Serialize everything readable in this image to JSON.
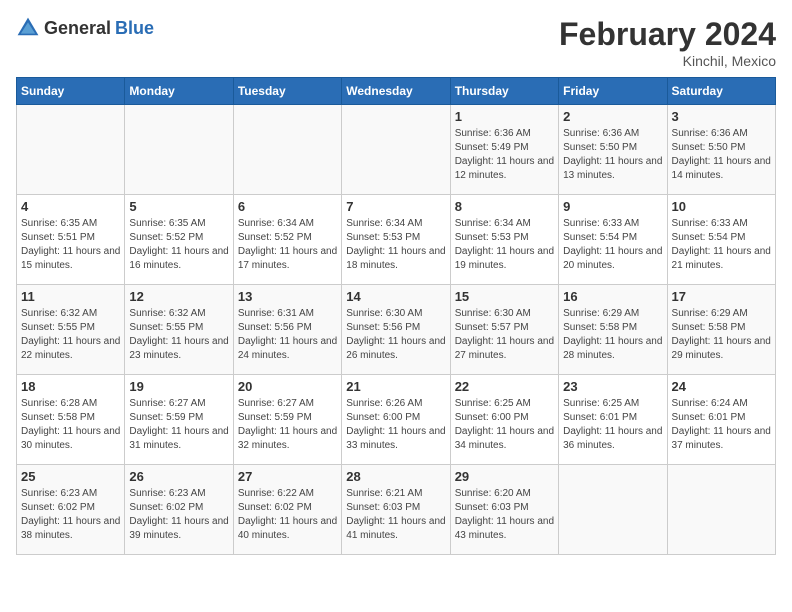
{
  "header": {
    "logo_general": "General",
    "logo_blue": "Blue",
    "month_year": "February 2024",
    "location": "Kinchil, Mexico"
  },
  "weekdays": [
    "Sunday",
    "Monday",
    "Tuesday",
    "Wednesday",
    "Thursday",
    "Friday",
    "Saturday"
  ],
  "weeks": [
    [
      {
        "day": "",
        "info": ""
      },
      {
        "day": "",
        "info": ""
      },
      {
        "day": "",
        "info": ""
      },
      {
        "day": "",
        "info": ""
      },
      {
        "day": "1",
        "info": "Sunrise: 6:36 AM\nSunset: 5:49 PM\nDaylight: 11 hours and 12 minutes."
      },
      {
        "day": "2",
        "info": "Sunrise: 6:36 AM\nSunset: 5:50 PM\nDaylight: 11 hours and 13 minutes."
      },
      {
        "day": "3",
        "info": "Sunrise: 6:36 AM\nSunset: 5:50 PM\nDaylight: 11 hours and 14 minutes."
      }
    ],
    [
      {
        "day": "4",
        "info": "Sunrise: 6:35 AM\nSunset: 5:51 PM\nDaylight: 11 hours and 15 minutes."
      },
      {
        "day": "5",
        "info": "Sunrise: 6:35 AM\nSunset: 5:52 PM\nDaylight: 11 hours and 16 minutes."
      },
      {
        "day": "6",
        "info": "Sunrise: 6:34 AM\nSunset: 5:52 PM\nDaylight: 11 hours and 17 minutes."
      },
      {
        "day": "7",
        "info": "Sunrise: 6:34 AM\nSunset: 5:53 PM\nDaylight: 11 hours and 18 minutes."
      },
      {
        "day": "8",
        "info": "Sunrise: 6:34 AM\nSunset: 5:53 PM\nDaylight: 11 hours and 19 minutes."
      },
      {
        "day": "9",
        "info": "Sunrise: 6:33 AM\nSunset: 5:54 PM\nDaylight: 11 hours and 20 minutes."
      },
      {
        "day": "10",
        "info": "Sunrise: 6:33 AM\nSunset: 5:54 PM\nDaylight: 11 hours and 21 minutes."
      }
    ],
    [
      {
        "day": "11",
        "info": "Sunrise: 6:32 AM\nSunset: 5:55 PM\nDaylight: 11 hours and 22 minutes."
      },
      {
        "day": "12",
        "info": "Sunrise: 6:32 AM\nSunset: 5:55 PM\nDaylight: 11 hours and 23 minutes."
      },
      {
        "day": "13",
        "info": "Sunrise: 6:31 AM\nSunset: 5:56 PM\nDaylight: 11 hours and 24 minutes."
      },
      {
        "day": "14",
        "info": "Sunrise: 6:30 AM\nSunset: 5:56 PM\nDaylight: 11 hours and 26 minutes."
      },
      {
        "day": "15",
        "info": "Sunrise: 6:30 AM\nSunset: 5:57 PM\nDaylight: 11 hours and 27 minutes."
      },
      {
        "day": "16",
        "info": "Sunrise: 6:29 AM\nSunset: 5:58 PM\nDaylight: 11 hours and 28 minutes."
      },
      {
        "day": "17",
        "info": "Sunrise: 6:29 AM\nSunset: 5:58 PM\nDaylight: 11 hours and 29 minutes."
      }
    ],
    [
      {
        "day": "18",
        "info": "Sunrise: 6:28 AM\nSunset: 5:58 PM\nDaylight: 11 hours and 30 minutes."
      },
      {
        "day": "19",
        "info": "Sunrise: 6:27 AM\nSunset: 5:59 PM\nDaylight: 11 hours and 31 minutes."
      },
      {
        "day": "20",
        "info": "Sunrise: 6:27 AM\nSunset: 5:59 PM\nDaylight: 11 hours and 32 minutes."
      },
      {
        "day": "21",
        "info": "Sunrise: 6:26 AM\nSunset: 6:00 PM\nDaylight: 11 hours and 33 minutes."
      },
      {
        "day": "22",
        "info": "Sunrise: 6:25 AM\nSunset: 6:00 PM\nDaylight: 11 hours and 34 minutes."
      },
      {
        "day": "23",
        "info": "Sunrise: 6:25 AM\nSunset: 6:01 PM\nDaylight: 11 hours and 36 minutes."
      },
      {
        "day": "24",
        "info": "Sunrise: 6:24 AM\nSunset: 6:01 PM\nDaylight: 11 hours and 37 minutes."
      }
    ],
    [
      {
        "day": "25",
        "info": "Sunrise: 6:23 AM\nSunset: 6:02 PM\nDaylight: 11 hours and 38 minutes."
      },
      {
        "day": "26",
        "info": "Sunrise: 6:23 AM\nSunset: 6:02 PM\nDaylight: 11 hours and 39 minutes."
      },
      {
        "day": "27",
        "info": "Sunrise: 6:22 AM\nSunset: 6:02 PM\nDaylight: 11 hours and 40 minutes."
      },
      {
        "day": "28",
        "info": "Sunrise: 6:21 AM\nSunset: 6:03 PM\nDaylight: 11 hours and 41 minutes."
      },
      {
        "day": "29",
        "info": "Sunrise: 6:20 AM\nSunset: 6:03 PM\nDaylight: 11 hours and 43 minutes."
      },
      {
        "day": "",
        "info": ""
      },
      {
        "day": "",
        "info": ""
      }
    ]
  ]
}
